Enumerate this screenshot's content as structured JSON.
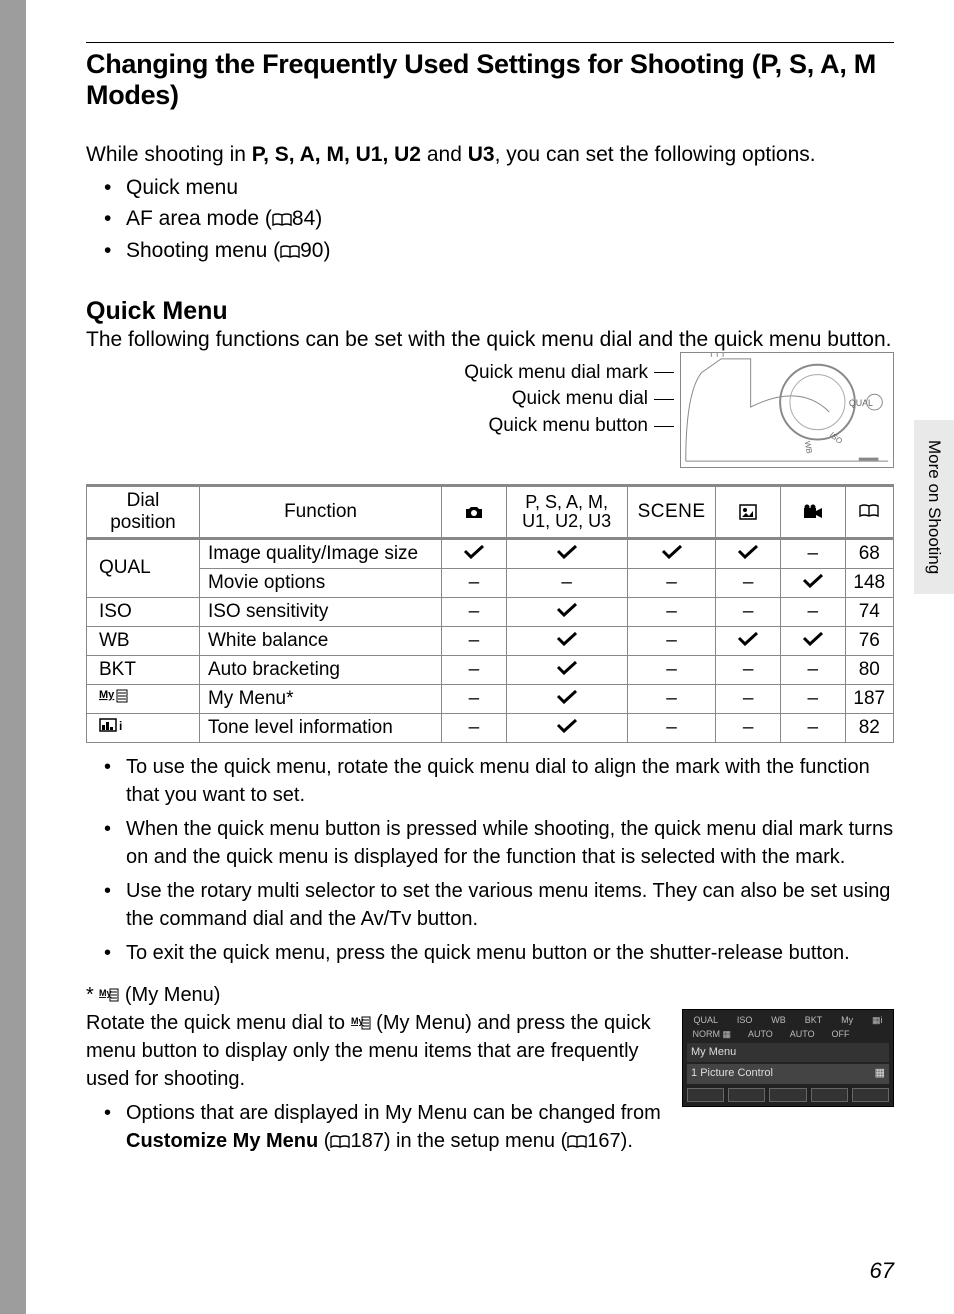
{
  "header": {
    "title_pre": "Changing the Frequently Used Settings for Shooting (",
    "title_modes": "P, S, A, M",
    "title_post": " Modes)"
  },
  "intro": {
    "line_pre": "While shooting in ",
    "modes": "P, S, A, M, U1, U2",
    "modes_and": " and ",
    "modes_last": "U3",
    "line_post": ", you can set the following options.",
    "bullets": [
      {
        "text": "Quick menu",
        "ref": ""
      },
      {
        "text": "AF area mode (",
        "ref": "84",
        "close": ")"
      },
      {
        "text": "Shooting menu (",
        "ref": "90",
        "close": ")"
      }
    ]
  },
  "quickmenu": {
    "heading": "Quick Menu",
    "desc": "The following functions can be set with the quick menu dial and the quick menu button.",
    "labels": [
      "Quick menu dial mark",
      "Quick menu dial",
      "Quick menu button"
    ]
  },
  "table": {
    "headers": {
      "dial": "Dial position",
      "func": "Function",
      "psam": "P, S, A, M, U1, U2, U3",
      "scene": "SCENE"
    },
    "rows": [
      {
        "dial": "QUAL",
        "dial_span": 2,
        "fn": "Image quality/Image size",
        "a": "v",
        "b": "v",
        "c": "v",
        "d": "v",
        "e": "-",
        "pg": "68"
      },
      {
        "dial": "",
        "fn": "Movie options",
        "a": "-",
        "b": "-",
        "c": "-",
        "d": "-",
        "e": "v",
        "pg": "148"
      },
      {
        "dial": "ISO",
        "fn": "ISO sensitivity",
        "a": "-",
        "b": "v",
        "c": "-",
        "d": "-",
        "e": "-",
        "pg": "74"
      },
      {
        "dial": "WB",
        "fn": "White balance",
        "a": "-",
        "b": "v",
        "c": "-",
        "d": "v",
        "e": "v",
        "pg": "76"
      },
      {
        "dial": "BKT",
        "fn": "Auto bracketing",
        "a": "-",
        "b": "v",
        "c": "-",
        "d": "-",
        "e": "-",
        "pg": "80"
      },
      {
        "dial": "My",
        "fn": "My Menu*",
        "a": "-",
        "b": "v",
        "c": "-",
        "d": "-",
        "e": "-",
        "pg": "187"
      },
      {
        "dial": "▦i",
        "fn": "Tone level information",
        "a": "-",
        "b": "v",
        "c": "-",
        "d": "-",
        "e": "-",
        "pg": "82"
      }
    ]
  },
  "notes": [
    "To use the quick menu, rotate the quick menu dial to align the mark with the function that you want to set.",
    "When the quick menu button is pressed while shooting, the quick menu dial mark turns on and the quick menu is displayed for the function that is selected with the mark.",
    "Use the rotary multi selector to set the various menu items. They can also be set using the command dial and the Av/Tv button.",
    "To exit the quick menu, press the quick menu button or the shutter-release button."
  ],
  "mymenu": {
    "star_line": "* ",
    "star_label": " (My Menu)",
    "para": "Rotate the quick menu dial to ",
    "para2": " (My Menu) and press the quick menu button to display only the menu items that are frequently used for shooting.",
    "bullet_pre": "Options that are displayed in My Menu can be changed from ",
    "bullet_bold": "Customize My Menu",
    "bullet_mid": " (",
    "bullet_ref1": "187",
    "bullet_mid2": ") in the setup menu (",
    "bullet_ref2": "167",
    "bullet_end": ")."
  },
  "lcd": {
    "bar": [
      "QUAL",
      "ISO",
      "WB",
      "BKT",
      "My",
      "▦i"
    ],
    "bar2": [
      "NORM ▦",
      "AUTO",
      "AUTO",
      "OFF",
      "",
      ""
    ],
    "mm": "My Menu",
    "pc_num": "1",
    "pc": "Picture Control"
  },
  "side_tab": "More on Shooting",
  "page_number": "67"
}
